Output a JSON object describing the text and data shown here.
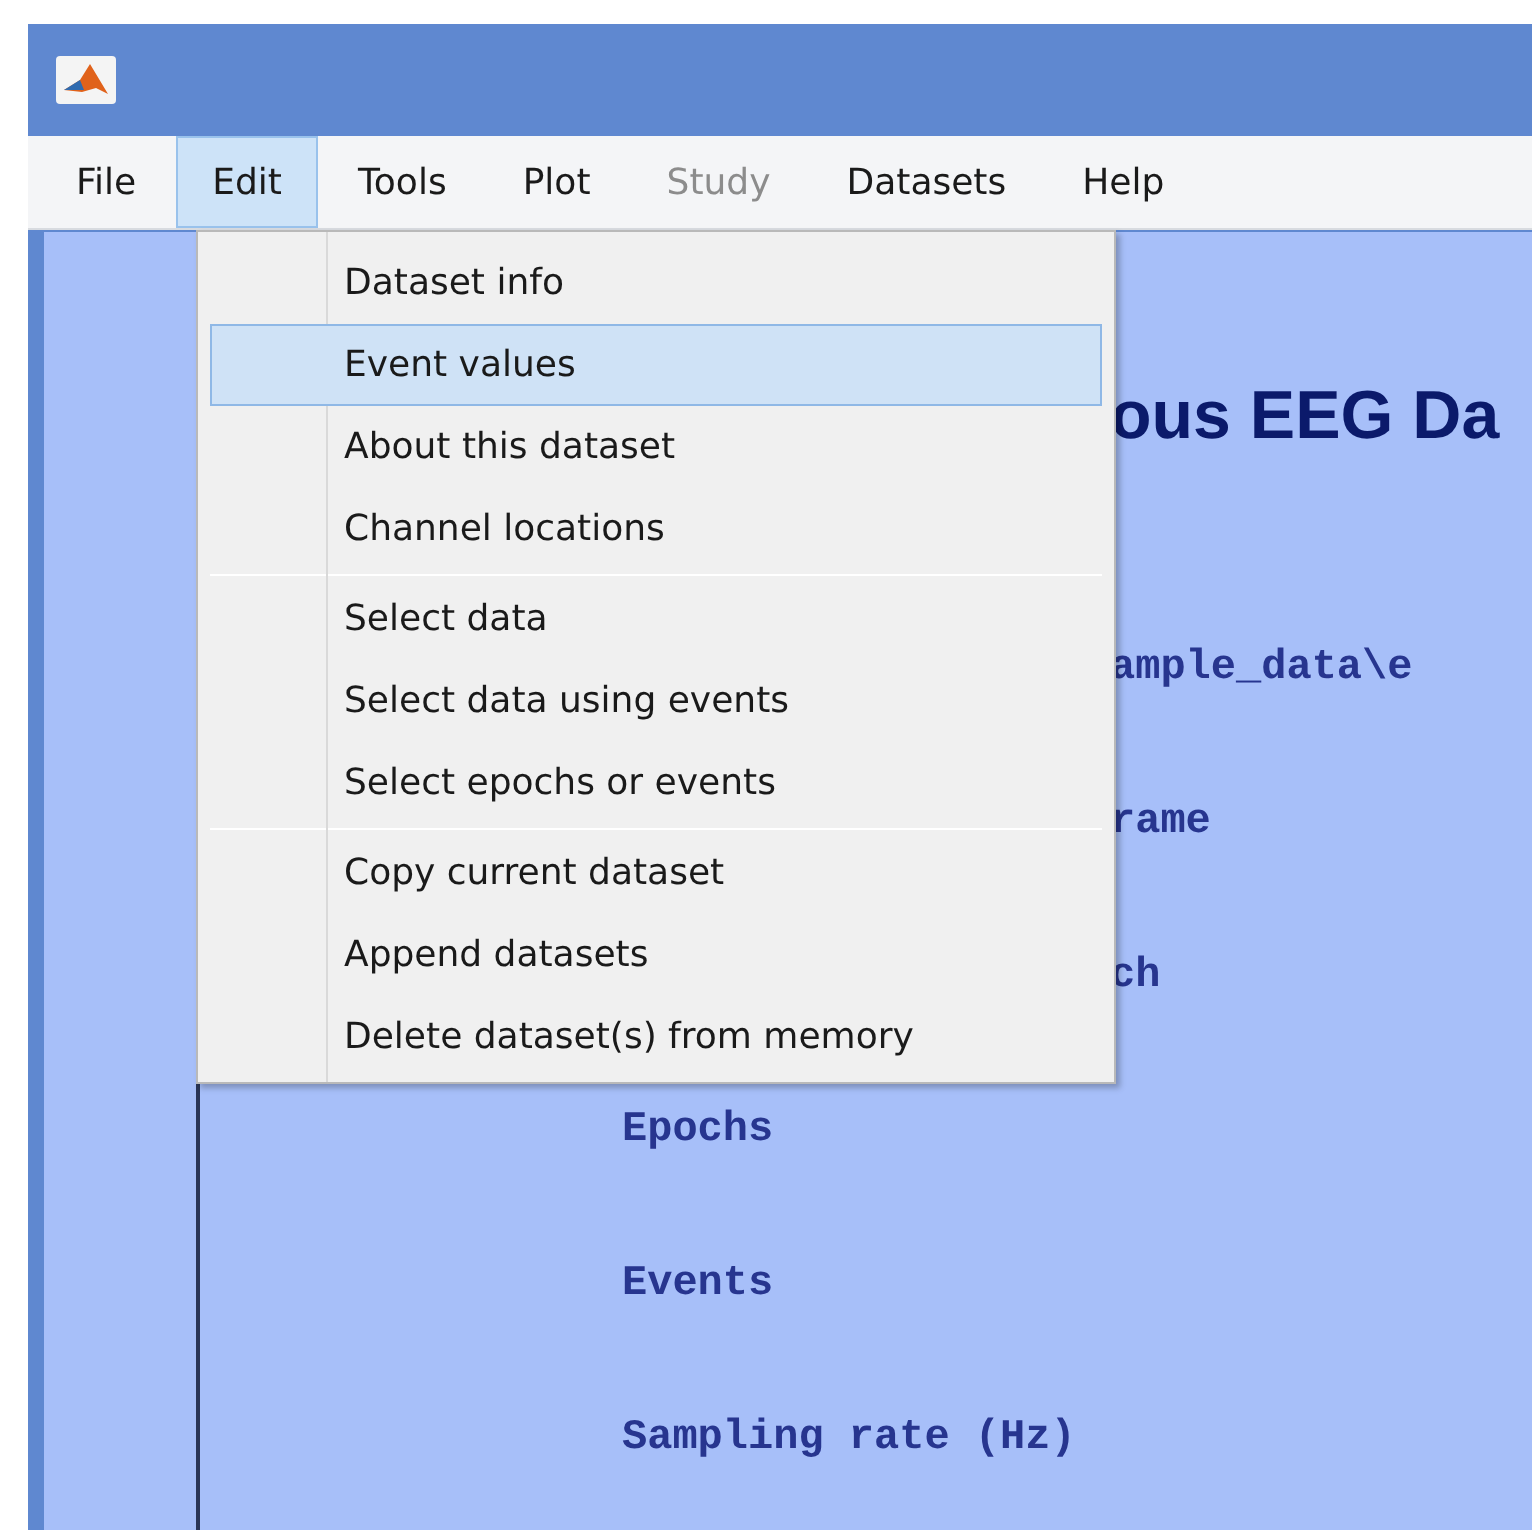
{
  "menubar": [
    {
      "label": "File",
      "open": false,
      "disabled": false
    },
    {
      "label": "Edit",
      "open": true,
      "disabled": false
    },
    {
      "label": "Tools",
      "open": false,
      "disabled": false
    },
    {
      "label": "Plot",
      "open": false,
      "disabled": false
    },
    {
      "label": "Study",
      "open": false,
      "disabled": true
    },
    {
      "label": "Datasets",
      "open": false,
      "disabled": false
    },
    {
      "label": "Help",
      "open": false,
      "disabled": false
    }
  ],
  "edit_menu": {
    "groups": [
      [
        {
          "label": "Dataset info",
          "selected": false
        },
        {
          "label": "Event values",
          "selected": true
        },
        {
          "label": "About this dataset",
          "selected": false
        },
        {
          "label": "Channel locations",
          "selected": false
        }
      ],
      [
        {
          "label": "Select data",
          "selected": false
        },
        {
          "label": "Select data using events",
          "selected": false
        },
        {
          "label": "Select epochs or events",
          "selected": false
        }
      ],
      [
        {
          "label": "Copy current dataset",
          "selected": false
        },
        {
          "label": "Append datasets",
          "selected": false
        },
        {
          "label": "Delete dataset(s) from memory",
          "selected": false
        }
      ]
    ]
  },
  "content": {
    "title": "ous EEG Da",
    "rows_behind_menu": [
      "ample_data\\e",
      "rame",
      "ch"
    ],
    "rows": [
      "Epochs",
      "Events",
      "Sampling rate (Hz)"
    ]
  }
}
